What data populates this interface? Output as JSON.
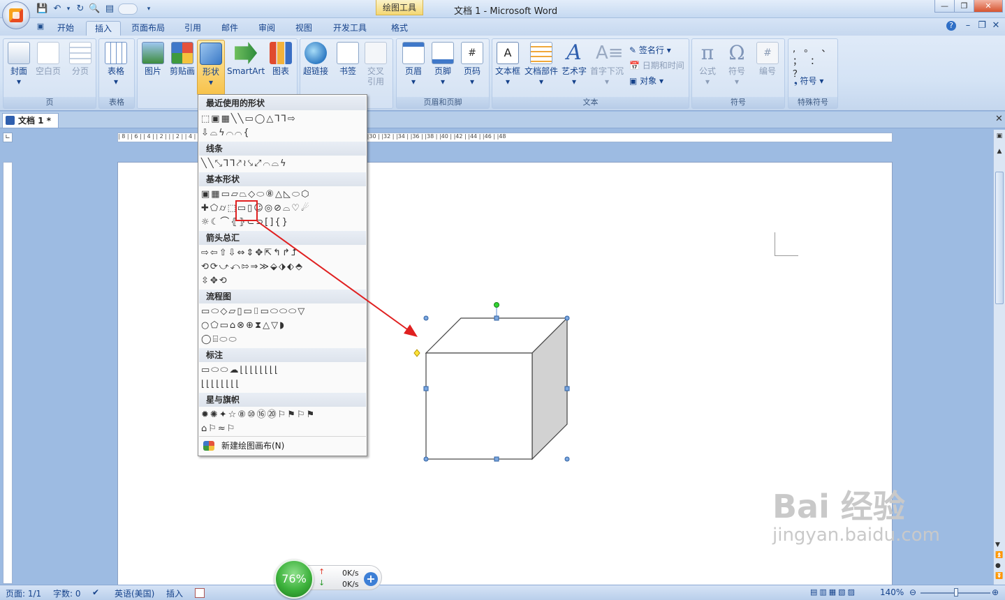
{
  "window": {
    "title": "文档 1 - Microsoft Word",
    "context_tab": "绘图工具",
    "controls": [
      "—",
      "❐",
      "✕"
    ]
  },
  "tabs": [
    {
      "label": "开始"
    },
    {
      "label": "插入",
      "active": true
    },
    {
      "label": "页面布局"
    },
    {
      "label": "引用"
    },
    {
      "label": "邮件"
    },
    {
      "label": "审阅"
    },
    {
      "label": "视图"
    },
    {
      "label": "开发工具"
    },
    {
      "label": "格式"
    }
  ],
  "ribbon": {
    "groups": {
      "page": {
        "label": "页",
        "buttons": [
          "封面",
          "空白页",
          "分页"
        ]
      },
      "table": {
        "label": "表格",
        "buttons": [
          "表格"
        ]
      },
      "illustrations": {
        "buttons": [
          "图片",
          "剪贴画",
          "形状",
          "SmartArt",
          "图表"
        ]
      },
      "links": {
        "buttons": [
          "超链接",
          "书签",
          "交叉",
          "引用"
        ]
      },
      "header_footer": {
        "label": "页眉和页脚",
        "buttons": [
          "页眉",
          "页脚",
          "页码"
        ]
      },
      "text": {
        "label": "文本",
        "buttons": [
          "文本框",
          "文档部件",
          "艺术字",
          "首字下沉"
        ],
        "side": [
          "签名行 ▾",
          "日期和时间",
          "对象 ▾"
        ]
      },
      "symbols": {
        "label": "符号",
        "buttons": [
          "公式",
          "符号",
          "编号"
        ]
      },
      "special": {
        "label": "特殊符号",
        "glyphs": ",  。 、 ；  ：  ？",
        "button": "符号 ▾"
      }
    }
  },
  "doc_tab": {
    "label": "文档 1 *"
  },
  "ruler": {
    "ticks": "| 8 |  | 6 |  | 4 |  | 2 |  |   | 2 |  | 4 |  | 6 |  | 8 |  |10 |  |12 |  |14 |  |16 |  |18 |  |20 |  |22 |  |24 |  |26 |  |28 |  |30 |  |32 |  |34 |  |36 |  |38 |  |40 |  |42 |  |44 |  |46 |  |48"
  },
  "shapes_menu": {
    "sections": [
      {
        "title": "最近使用的形状",
        "rows": [
          "⬚▣▦╲╲▭◯△⅂⅂⇨",
          "⇩⌓ϟ⌒⌒{"
        ]
      },
      {
        "title": "线条",
        "rows": [
          "╲╲⤡⅂⅂⤤≀⤥⤢⌒⌓ϟ"
        ]
      },
      {
        "title": "基本形状",
        "rows": [
          "▣▦▭▱⏢◇⬭⑧△◺⬭⬡",
          "✚⬠⌭⬚▭▯☺◎⊘⌓♡☄",
          "☼☾⌒⦃⦄⊂⊃[]{}"
        ]
      },
      {
        "title": "箭头总汇",
        "rows": [
          "⇨⇦⇧⇩⇔⇕✥⇱↰↱⮥",
          "⟲⟳⤻⤺⇰⇒≫⬙⬗⬖⬘",
          "⇳✥⟲"
        ]
      },
      {
        "title": "流程图",
        "rows": [
          "▭⬭◇▱▯▭⌷▭⬭⬭⬭▽",
          "○⬠▭⌂⊗⊕⧗△▽◗",
          "◯⌸⬭⬭"
        ]
      },
      {
        "title": "标注",
        "rows": [
          "▭⬭⬭☁⌊⌊⌊⌊⌊⌊⌊⌊",
          "⌊⌊⌊⌊⌊⌊⌊⌊"
        ]
      },
      {
        "title": "星与旗帜",
        "rows": [
          "✹✺✦☆⑧⑩⑯⑳⚐⚑⚐⚑",
          "⌂⚐≈⚐"
        ]
      }
    ],
    "new_canvas": "新建绘图画布(N)"
  },
  "status": {
    "page": "页面: 1/1",
    "words": "字数: 0",
    "lang": "英语(美国)",
    "mode": "插入",
    "zoom": "140%"
  },
  "net_widget": {
    "percent": "76%",
    "up": "0K/s",
    "down": "0K/s"
  },
  "watermark": {
    "brand": "Bai  经验",
    "url": "jingyan.baidu.com"
  }
}
